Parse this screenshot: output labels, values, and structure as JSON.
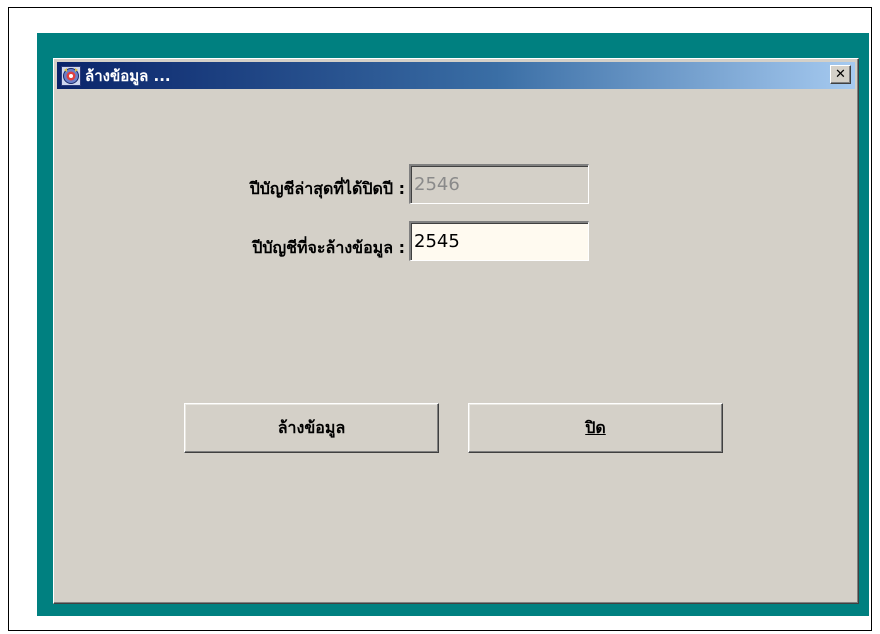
{
  "window": {
    "title": "ล้างข้อมูล ...",
    "close_label": "✕"
  },
  "form": {
    "latest_closed_year": {
      "label": "ปีบัญชีล่าสุดที่ได้ปิดปี :",
      "value": "2546",
      "disabled": true
    },
    "year_to_clear": {
      "label": "ปีบัญชีที่จะล้างข้อมูล :",
      "value": "2545"
    }
  },
  "buttons": {
    "clear_label": "ล้างข้อมูล",
    "close_label": "ปิด"
  },
  "colors": {
    "desktop": "#008080",
    "dialog_face": "#d4d0c8",
    "title_gradient_start": "#0a246a",
    "title_gradient_end": "#a6caf0",
    "input_bg": "#fffaf0"
  },
  "icons": {
    "app": "app-logo-icon",
    "close": "close-icon"
  }
}
